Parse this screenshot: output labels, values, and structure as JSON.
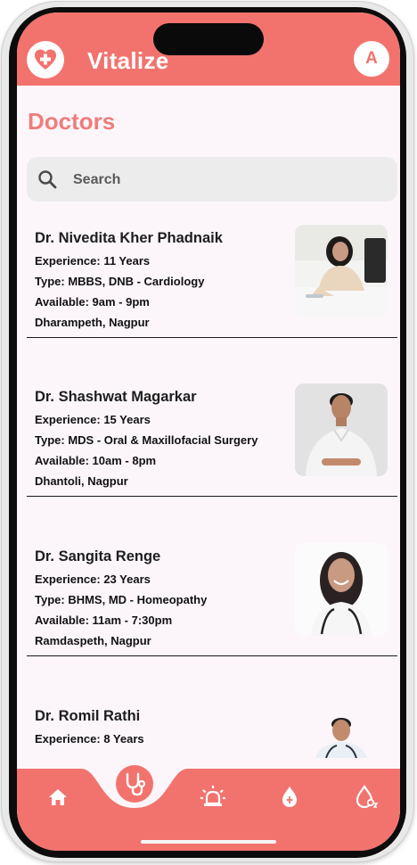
{
  "app": {
    "title": "Vitalize",
    "avatar_initial": "A"
  },
  "page": {
    "title": "Doctors"
  },
  "search": {
    "placeholder": "Search"
  },
  "doctors": [
    {
      "name": "Dr. Nivedita Kher Phadnaik",
      "experience": "Experience: 11 Years",
      "type": "Type: MBBS, DNB - Cardiology",
      "available": "Available: 9am - 9pm",
      "location": "Dharampeth, Nagpur"
    },
    {
      "name": "Dr. Shashwat Magarkar",
      "experience": "Experience: 15 Years",
      "type": "Type: MDS - Oral & Maxillofacial Surgery",
      "available": "Available: 10am - 8pm",
      "location": "Dhantoli, Nagpur"
    },
    {
      "name": "Dr. Sangita Renge",
      "experience": "Experience: 23 Years",
      "type": "Type: BHMS, MD - Homeopathy",
      "available": "Available: 11am - 7:30pm",
      "location": "Ramdaspeth, Nagpur"
    },
    {
      "name": "Dr. Romil Rathi",
      "experience": "Experience: 8 Years"
    }
  ],
  "nav": {
    "items": [
      "home-icon",
      "stethoscope-icon",
      "alarm-icon",
      "blood-drop-icon",
      "oxygen-icon"
    ],
    "active": "stethoscope-icon"
  },
  "colors": {
    "accent": "#f2736e",
    "title": "#ef7d7b",
    "background": "#fcf6fb"
  }
}
